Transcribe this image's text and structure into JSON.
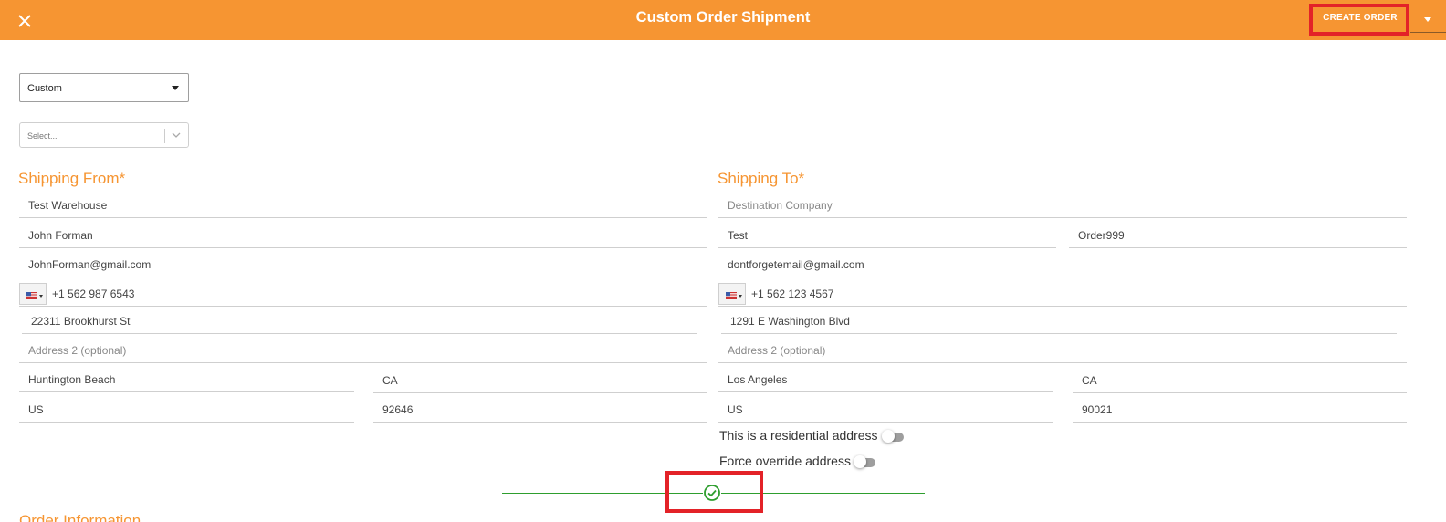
{
  "header": {
    "title": "Custom Order Shipment",
    "create_order_label": "CREATE ORDER",
    "close_icon": "close-icon",
    "dropdown_icon": "caret-down-icon"
  },
  "controls": {
    "order_type": {
      "value": "Custom"
    },
    "preset_select": {
      "placeholder": "Select..."
    }
  },
  "shipping_from": {
    "heading": "Shipping From*",
    "company": "Test Warehouse",
    "name": "John Forman",
    "email": "JohnForman@gmail.com",
    "phone": "+1 562 987 6543",
    "address1": "22311 Brookhurst St",
    "address2_placeholder": "Address 2 (optional)",
    "city": "Huntington Beach",
    "state": "CA",
    "country": "US",
    "zip": "92646"
  },
  "shipping_to": {
    "heading": "Shipping To*",
    "company_placeholder": "Destination Company",
    "first_name": "Test",
    "last_name": "Order999",
    "email": "dontforgetemail@gmail.com",
    "phone": "+1 562 123 4567",
    "address1": "1291 E Washington Blvd",
    "address2_placeholder": "Address 2 (optional)",
    "city": "Los Angeles",
    "state": "CA",
    "country": "US",
    "zip": "90021",
    "residential_label": "This is a residential address",
    "residential_on": false,
    "force_override_label": "Force override address",
    "force_override_on": false
  },
  "order_information": {
    "heading": "Order Information"
  },
  "status": {
    "icon": "check-circle-icon",
    "color": "#2e9e2e"
  },
  "colors": {
    "accent": "#f69532",
    "highlight": "#e32228",
    "success": "#2e9e2e"
  }
}
